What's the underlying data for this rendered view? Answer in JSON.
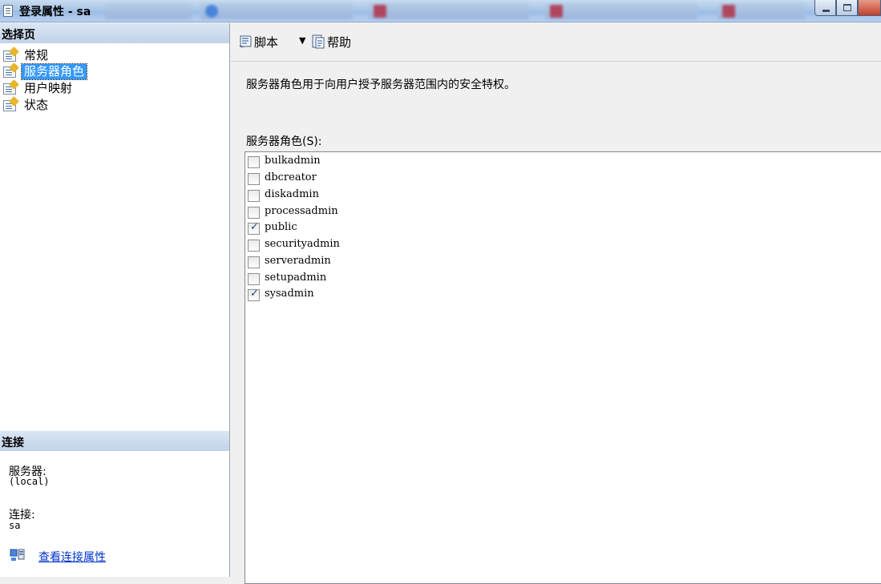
{
  "window": {
    "title": "登录属性 - sa"
  },
  "left_pane": {
    "select_page_header": "选择页",
    "nav_items": [
      {
        "label": "常规",
        "selected": false
      },
      {
        "label": "服务器角色",
        "selected": true
      },
      {
        "label": "用户映射",
        "selected": false
      },
      {
        "label": "状态",
        "selected": false
      }
    ],
    "connection": {
      "header": "连接",
      "server_label": "服务器:",
      "server_value": "(local)",
      "connection_label": "连接:",
      "connection_value": "sa",
      "view_link": "查看连接属性"
    }
  },
  "toolbar": {
    "script_label": "脚本",
    "help_label": "帮助"
  },
  "main": {
    "description": "服务器角色用于向用户授予服务器范围内的安全特权。",
    "roles_label": "服务器角色(S):",
    "roles": [
      {
        "name": "bulkadmin",
        "checked": false
      },
      {
        "name": "dbcreator",
        "checked": false
      },
      {
        "name": "diskadmin",
        "checked": false
      },
      {
        "name": "processadmin",
        "checked": false
      },
      {
        "name": "public",
        "checked": true
      },
      {
        "name": "securityadmin",
        "checked": false
      },
      {
        "name": "serveradmin",
        "checked": false
      },
      {
        "name": "setupadmin",
        "checked": false
      },
      {
        "name": "sysadmin",
        "checked": true
      }
    ]
  },
  "colors": {
    "selection": "#3399ff",
    "link": "#0033cc",
    "check_mark": "#21447f"
  }
}
